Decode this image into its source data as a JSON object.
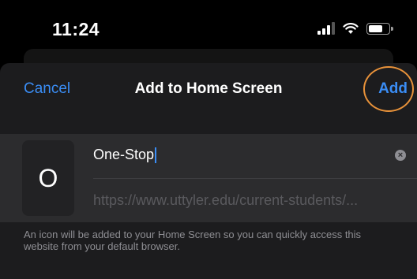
{
  "status_bar": {
    "time": "11:24",
    "icons": [
      "cellular-signal-icon",
      "wifi-icon",
      "battery-icon"
    ]
  },
  "sheet": {
    "cancel_label": "Cancel",
    "title": "Add to Home Screen",
    "add_label": "Add",
    "accent_color": "#3a8df5",
    "highlight_color": "#e8923a"
  },
  "form": {
    "icon_letter": "O",
    "name_value": "One-Stop",
    "url_value": "https://www.uttyler.edu/current-students/...",
    "clear_icon": "clear-circle-icon"
  },
  "footnote": "An icon will be added to your Home Screen so you can quickly access this website from your default browser."
}
